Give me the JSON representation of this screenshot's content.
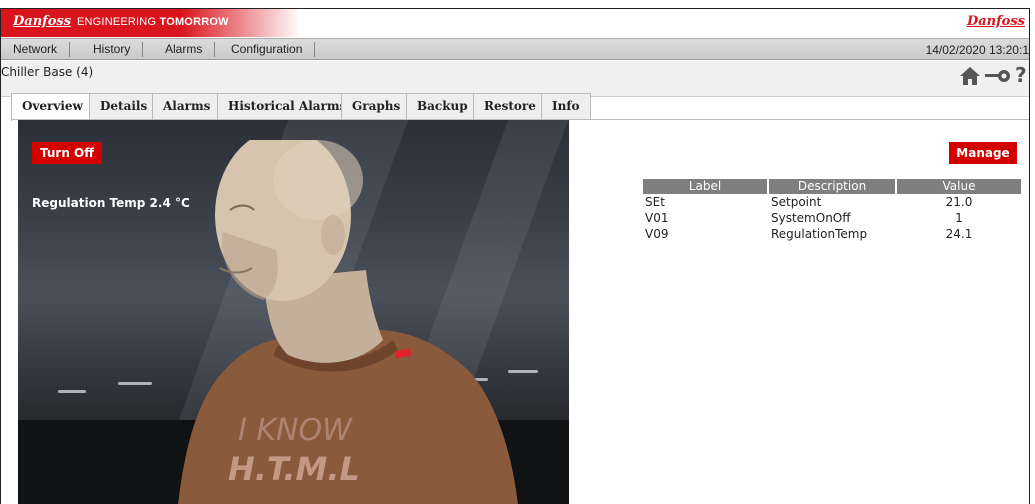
{
  "brand": {
    "logo": "Danfoss",
    "tagline_prefix": "ENGINEERING ",
    "tagline_bold": "TOMORROW",
    "logo_right": "Danfoss",
    "accent": "#d9141c"
  },
  "menu": {
    "items": [
      {
        "label": "Network"
      },
      {
        "label": "History"
      },
      {
        "label": "Alarms"
      },
      {
        "label": "Configuration"
      }
    ],
    "datetime": "14/02/2020 13:20:1"
  },
  "breadcrumb": "Chiller Base (4)",
  "toolbar": {
    "home_icon": "home-icon",
    "key_icon": "key-icon",
    "help_label": "?"
  },
  "tabs": [
    {
      "label": "Overview",
      "active": true
    },
    {
      "label": "Details"
    },
    {
      "label": "Alarms"
    },
    {
      "label": "Historical Alarms"
    },
    {
      "label": "Graphs"
    },
    {
      "label": "Backup"
    },
    {
      "label": "Restore"
    },
    {
      "label": "Info"
    }
  ],
  "overview": {
    "turn_off_label": "Turn Off",
    "regulation_temp": "Regulation Temp 2.4 °C",
    "manage_label": "Manage",
    "button_color": "#d40000"
  },
  "table": {
    "headers": [
      "Label",
      "Description",
      "Value"
    ],
    "rows": [
      {
        "label": "SEt",
        "description": "Setpoint",
        "value": "21.0"
      },
      {
        "label": "V01",
        "description": "SystemOnOff",
        "value": "1"
      },
      {
        "label": "V09",
        "description": "RegulationTemp",
        "value": "24.1"
      }
    ]
  }
}
